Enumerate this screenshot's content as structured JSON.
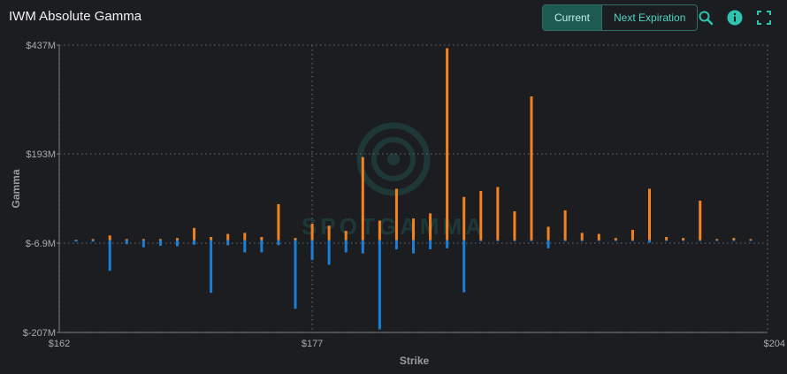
{
  "header": {
    "title": "IWM Absolute Gamma",
    "tabs": [
      {
        "label": "Current",
        "active": true
      },
      {
        "label": "Next Expiration",
        "active": false
      }
    ],
    "icons": [
      "search-icon",
      "info-icon",
      "fullscreen-icon"
    ]
  },
  "colors": {
    "positive": "#f5821f",
    "negative": "#1c7fd6",
    "grid": "#5c5e62",
    "accent": "#2ec4b0"
  },
  "chart_data": {
    "type": "bar",
    "xlabel": "Strike",
    "ylabel": "Gamma",
    "x_ticks": [
      {
        "value": 162,
        "label": "$162"
      },
      {
        "value": 177,
        "label": "$177"
      },
      {
        "value": 204,
        "label": "$204"
      }
    ],
    "y_ticks": [
      {
        "value": 437,
        "label": "$437M"
      },
      {
        "value": 193,
        "label": "$193M"
      },
      {
        "value": -6.9,
        "label": "$-6.9M"
      },
      {
        "value": -207,
        "label": "$-207M"
      }
    ],
    "xlim": [
      162,
      204
    ],
    "ylim": [
      -207,
      437
    ],
    "grid": true,
    "series": [
      {
        "sign": "positive",
        "x": [
          163,
          164,
          165,
          166,
          167,
          168,
          169,
          170,
          171,
          172,
          173,
          174,
          175,
          176,
          177,
          178,
          179,
          180,
          181,
          182,
          183,
          184,
          185,
          186,
          187,
          188,
          189,
          190,
          191,
          192,
          193,
          194,
          195,
          196,
          197,
          198,
          199,
          200,
          201,
          202,
          203
        ],
        "values": [
          0.7,
          2.3,
          10.4,
          2.3,
          2.3,
          2.3,
          4.6,
          27.2,
          6.9,
          13.8,
          16.1,
          6.9,
          80.5,
          4.6,
          36.8,
          32.2,
          20.7,
          186,
          43.7,
          115,
          48.3,
          59.8,
          430,
          96.6,
          110,
          119,
          64.4,
          322,
          29.9,
          66.7,
          16.1,
          13.8,
          4.6,
          23,
          115,
          6.9,
          4.6,
          88.3,
          2.3,
          4.6,
          2.3
        ]
      },
      {
        "sign": "negative",
        "x": [
          163,
          164,
          165,
          166,
          167,
          168,
          169,
          170,
          171,
          172,
          173,
          174,
          175,
          176,
          177,
          178,
          179,
          180,
          181,
          182,
          183,
          184,
          185,
          186,
          187,
          188,
          189,
          190,
          191,
          192,
          193,
          194,
          195,
          196,
          197,
          198,
          199,
          200,
          201,
          202,
          203
        ],
        "values": [
          -3.5,
          -3.5,
          -69,
          -9.2,
          -16.1,
          -12.7,
          -13.8,
          -10.4,
          -118,
          -11.5,
          -27.6,
          -27.6,
          -11.5,
          -154,
          -44.8,
          -55.2,
          -27.6,
          -29.9,
          -200,
          -20.7,
          -29.9,
          -20.7,
          -18.4,
          -117,
          -2.3,
          -2.3,
          -2.3,
          -2.3,
          -18.4,
          -2.3,
          -2.3,
          -1.2,
          -1.2,
          -1.2,
          -5.8,
          -1.2,
          -1.2,
          -1.2,
          -1.2,
          -0.6,
          -0.6
        ]
      }
    ]
  }
}
